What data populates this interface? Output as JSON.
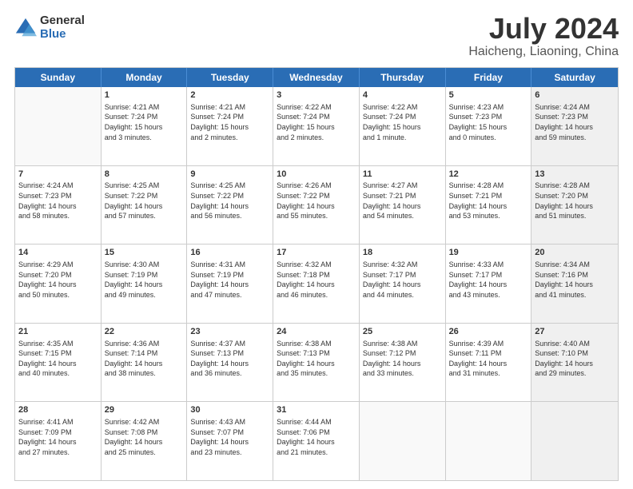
{
  "header": {
    "logo_general": "General",
    "logo_blue": "Blue",
    "month_title": "July 2024",
    "location": "Haicheng, Liaoning, China"
  },
  "weekdays": [
    "Sunday",
    "Monday",
    "Tuesday",
    "Wednesday",
    "Thursday",
    "Friday",
    "Saturday"
  ],
  "rows": [
    [
      {
        "day": "",
        "lines": [],
        "empty": true
      },
      {
        "day": "1",
        "lines": [
          "Sunrise: 4:21 AM",
          "Sunset: 7:24 PM",
          "Daylight: 15 hours",
          "and 3 minutes."
        ]
      },
      {
        "day": "2",
        "lines": [
          "Sunrise: 4:21 AM",
          "Sunset: 7:24 PM",
          "Daylight: 15 hours",
          "and 2 minutes."
        ]
      },
      {
        "day": "3",
        "lines": [
          "Sunrise: 4:22 AM",
          "Sunset: 7:24 PM",
          "Daylight: 15 hours",
          "and 2 minutes."
        ]
      },
      {
        "day": "4",
        "lines": [
          "Sunrise: 4:22 AM",
          "Sunset: 7:24 PM",
          "Daylight: 15 hours",
          "and 1 minute."
        ]
      },
      {
        "day": "5",
        "lines": [
          "Sunrise: 4:23 AM",
          "Sunset: 7:23 PM",
          "Daylight: 15 hours",
          "and 0 minutes."
        ]
      },
      {
        "day": "6",
        "lines": [
          "Sunrise: 4:24 AM",
          "Sunset: 7:23 PM",
          "Daylight: 14 hours",
          "and 59 minutes."
        ],
        "shaded": true
      }
    ],
    [
      {
        "day": "7",
        "lines": [
          "Sunrise: 4:24 AM",
          "Sunset: 7:23 PM",
          "Daylight: 14 hours",
          "and 58 minutes."
        ]
      },
      {
        "day": "8",
        "lines": [
          "Sunrise: 4:25 AM",
          "Sunset: 7:22 PM",
          "Daylight: 14 hours",
          "and 57 minutes."
        ]
      },
      {
        "day": "9",
        "lines": [
          "Sunrise: 4:25 AM",
          "Sunset: 7:22 PM",
          "Daylight: 14 hours",
          "and 56 minutes."
        ]
      },
      {
        "day": "10",
        "lines": [
          "Sunrise: 4:26 AM",
          "Sunset: 7:22 PM",
          "Daylight: 14 hours",
          "and 55 minutes."
        ]
      },
      {
        "day": "11",
        "lines": [
          "Sunrise: 4:27 AM",
          "Sunset: 7:21 PM",
          "Daylight: 14 hours",
          "and 54 minutes."
        ]
      },
      {
        "day": "12",
        "lines": [
          "Sunrise: 4:28 AM",
          "Sunset: 7:21 PM",
          "Daylight: 14 hours",
          "and 53 minutes."
        ]
      },
      {
        "day": "13",
        "lines": [
          "Sunrise: 4:28 AM",
          "Sunset: 7:20 PM",
          "Daylight: 14 hours",
          "and 51 minutes."
        ],
        "shaded": true
      }
    ],
    [
      {
        "day": "14",
        "lines": [
          "Sunrise: 4:29 AM",
          "Sunset: 7:20 PM",
          "Daylight: 14 hours",
          "and 50 minutes."
        ]
      },
      {
        "day": "15",
        "lines": [
          "Sunrise: 4:30 AM",
          "Sunset: 7:19 PM",
          "Daylight: 14 hours",
          "and 49 minutes."
        ]
      },
      {
        "day": "16",
        "lines": [
          "Sunrise: 4:31 AM",
          "Sunset: 7:19 PM",
          "Daylight: 14 hours",
          "and 47 minutes."
        ]
      },
      {
        "day": "17",
        "lines": [
          "Sunrise: 4:32 AM",
          "Sunset: 7:18 PM",
          "Daylight: 14 hours",
          "and 46 minutes."
        ]
      },
      {
        "day": "18",
        "lines": [
          "Sunrise: 4:32 AM",
          "Sunset: 7:17 PM",
          "Daylight: 14 hours",
          "and 44 minutes."
        ]
      },
      {
        "day": "19",
        "lines": [
          "Sunrise: 4:33 AM",
          "Sunset: 7:17 PM",
          "Daylight: 14 hours",
          "and 43 minutes."
        ]
      },
      {
        "day": "20",
        "lines": [
          "Sunrise: 4:34 AM",
          "Sunset: 7:16 PM",
          "Daylight: 14 hours",
          "and 41 minutes."
        ],
        "shaded": true
      }
    ],
    [
      {
        "day": "21",
        "lines": [
          "Sunrise: 4:35 AM",
          "Sunset: 7:15 PM",
          "Daylight: 14 hours",
          "and 40 minutes."
        ]
      },
      {
        "day": "22",
        "lines": [
          "Sunrise: 4:36 AM",
          "Sunset: 7:14 PM",
          "Daylight: 14 hours",
          "and 38 minutes."
        ]
      },
      {
        "day": "23",
        "lines": [
          "Sunrise: 4:37 AM",
          "Sunset: 7:13 PM",
          "Daylight: 14 hours",
          "and 36 minutes."
        ]
      },
      {
        "day": "24",
        "lines": [
          "Sunrise: 4:38 AM",
          "Sunset: 7:13 PM",
          "Daylight: 14 hours",
          "and 35 minutes."
        ]
      },
      {
        "day": "25",
        "lines": [
          "Sunrise: 4:38 AM",
          "Sunset: 7:12 PM",
          "Daylight: 14 hours",
          "and 33 minutes."
        ]
      },
      {
        "day": "26",
        "lines": [
          "Sunrise: 4:39 AM",
          "Sunset: 7:11 PM",
          "Daylight: 14 hours",
          "and 31 minutes."
        ]
      },
      {
        "day": "27",
        "lines": [
          "Sunrise: 4:40 AM",
          "Sunset: 7:10 PM",
          "Daylight: 14 hours",
          "and 29 minutes."
        ],
        "shaded": true
      }
    ],
    [
      {
        "day": "28",
        "lines": [
          "Sunrise: 4:41 AM",
          "Sunset: 7:09 PM",
          "Daylight: 14 hours",
          "and 27 minutes."
        ]
      },
      {
        "day": "29",
        "lines": [
          "Sunrise: 4:42 AM",
          "Sunset: 7:08 PM",
          "Daylight: 14 hours",
          "and 25 minutes."
        ]
      },
      {
        "day": "30",
        "lines": [
          "Sunrise: 4:43 AM",
          "Sunset: 7:07 PM",
          "Daylight: 14 hours",
          "and 23 minutes."
        ]
      },
      {
        "day": "31",
        "lines": [
          "Sunrise: 4:44 AM",
          "Sunset: 7:06 PM",
          "Daylight: 14 hours",
          "and 21 minutes."
        ]
      },
      {
        "day": "",
        "lines": [],
        "empty": true
      },
      {
        "day": "",
        "lines": [],
        "empty": true
      },
      {
        "day": "",
        "lines": [],
        "empty": true,
        "shaded": true
      }
    ]
  ]
}
